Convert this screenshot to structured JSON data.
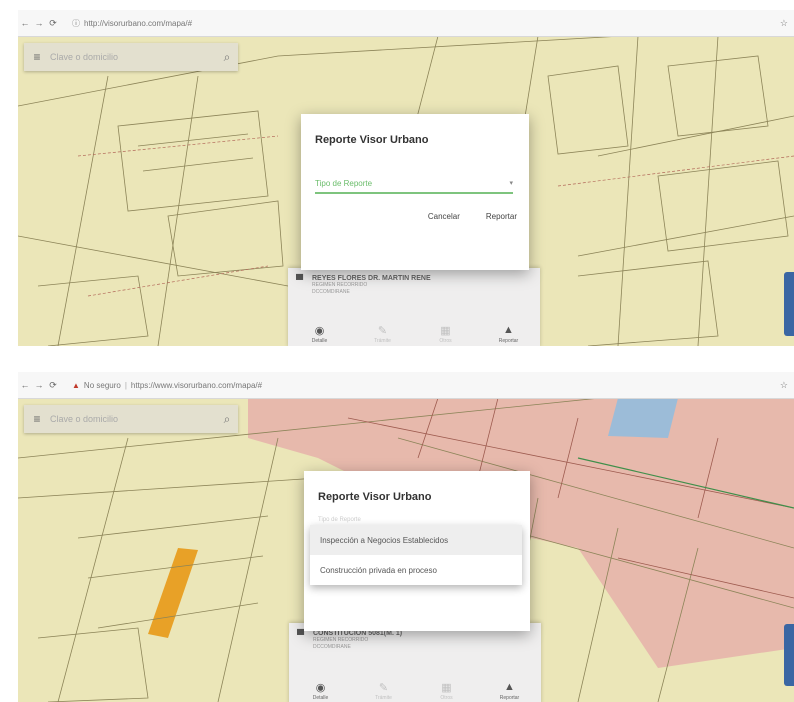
{
  "screenshots": [
    {
      "browser": {
        "back_icon": "←",
        "forward_icon": "→",
        "reload_icon": "⟳",
        "url": "http://visorurbano.com/mapa/#",
        "end_icon": "☆"
      },
      "search": {
        "menu_icon": "≡",
        "placeholder": "Clave o domicilio",
        "search_icon": "⌕"
      },
      "dialog": {
        "title": "Reporte Visor Urbano",
        "select_label": "Tipo de Reporte",
        "caret": "▾",
        "cancel": "Cancelar",
        "submit": "Reportar"
      },
      "card": {
        "icon": "▀",
        "name": "REYES FLORES DR. MARTIN RENE",
        "sub1": "REGIMEN RECORRIDO",
        "sub2": "DCCOMDIRANE",
        "actions": [
          {
            "icon": "◉",
            "label": "Detalle"
          },
          {
            "icon": "✎",
            "label": "Trámite"
          },
          {
            "icon": "▦",
            "label": "Otros"
          },
          {
            "icon": "▲",
            "label": "Reportar"
          }
        ]
      }
    },
    {
      "browser": {
        "back_icon": "←",
        "forward_icon": "→",
        "reload_icon": "⟳",
        "warn_icon": "▲",
        "security": "No seguro",
        "url": "https://www.visorurbano.com/mapa/#",
        "end_icon": "☆"
      },
      "search": {
        "menu_icon": "≡",
        "placeholder": "Clave o domicilio",
        "search_icon": "⌕"
      },
      "dialog": {
        "title": "Reporte Visor Urbano",
        "hint": "Tipo de Reporte",
        "options": [
          "Inspección a Negocios Establecidos",
          "Construcción privada en proceso"
        ]
      },
      "card": {
        "icon": "▀",
        "name": "CONSTITUCION 5081(M. 1)",
        "sub1": "REGIMEN RECORRIDO",
        "sub2": "DCCOMDIRANE",
        "actions": [
          {
            "icon": "◉",
            "label": "Detalle"
          },
          {
            "icon": "✎",
            "label": "Trámite"
          },
          {
            "icon": "▦",
            "label": "Otros"
          },
          {
            "icon": "▲",
            "label": "Reportar"
          }
        ]
      }
    }
  ]
}
